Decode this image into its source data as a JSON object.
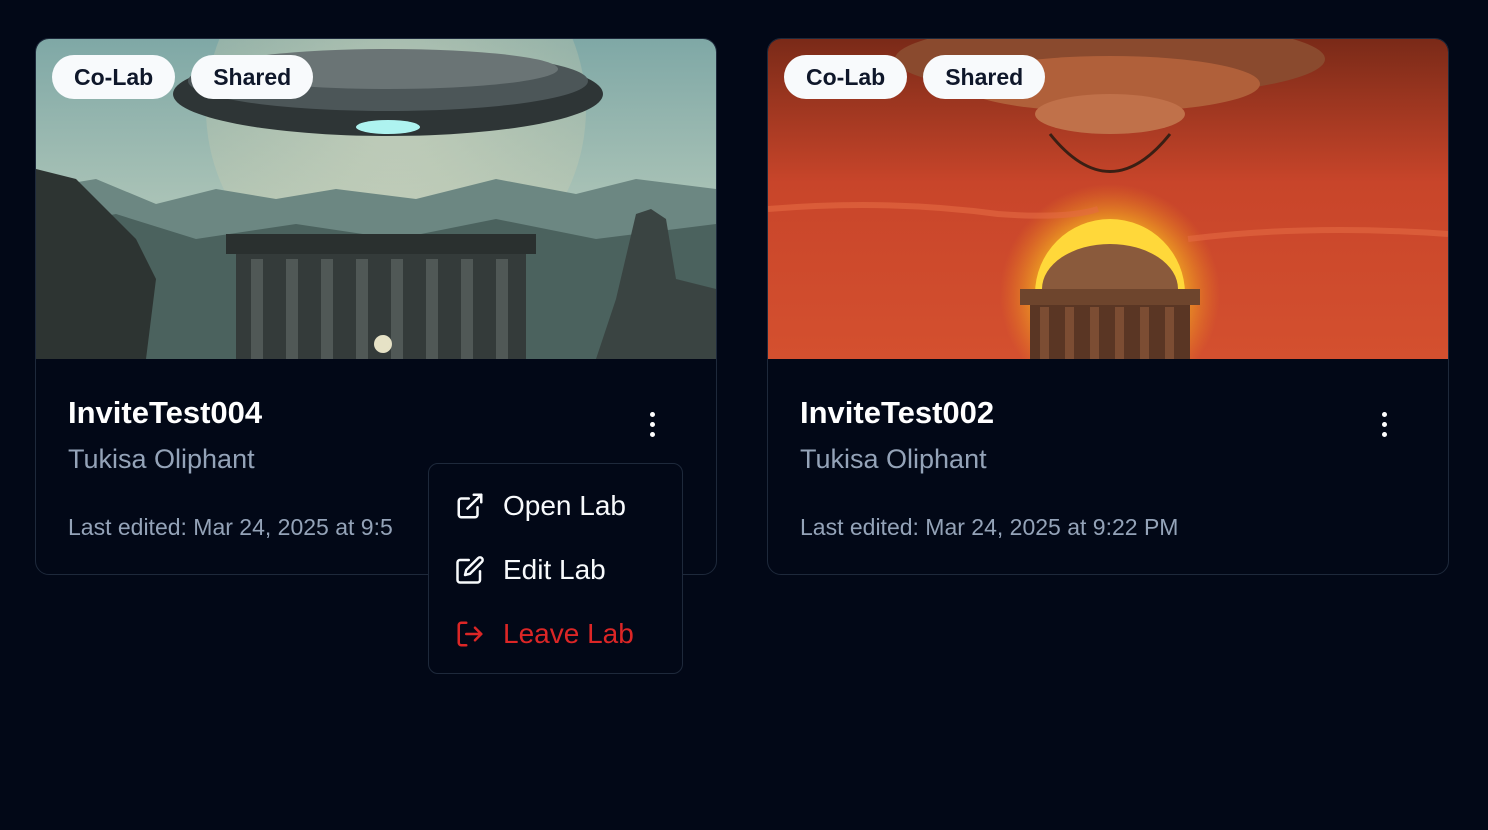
{
  "cards": [
    {
      "badges": [
        "Co-Lab",
        "Shared"
      ],
      "title": "InviteTest004",
      "owner": "Tukisa Oliphant",
      "last_edited": "Last edited: Mar 24, 2025 at 9:5",
      "image": "ufo-over-temple-daylight"
    },
    {
      "badges": [
        "Co-Lab",
        "Shared"
      ],
      "title": "InviteTest002",
      "owner": "Tukisa Oliphant",
      "last_edited": "Last edited: Mar 24, 2025 at 9:22 PM",
      "image": "ufo-over-temple-sunset"
    }
  ],
  "context_menu": {
    "items": [
      {
        "label": "Open Lab",
        "icon": "external-link-icon"
      },
      {
        "label": "Edit Lab",
        "icon": "edit-icon"
      },
      {
        "label": "Leave Lab",
        "icon": "log-out-icon",
        "color": "#dc2626"
      }
    ]
  },
  "colors": {
    "background": "#020817",
    "border": "#1e293b",
    "muted_text": "#94a3b8",
    "danger": "#dc2626"
  }
}
